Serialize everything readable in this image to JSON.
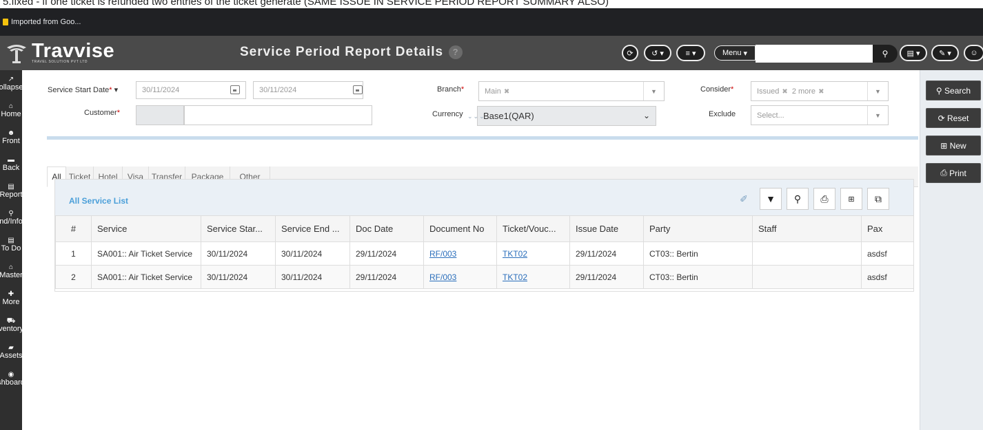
{
  "top_note": "5.fixed - if one ticket is refunded two entries of the ticket generate (SAME ISSUE IN SERVICE PERIOD REPORT SUMMARY ALSO)",
  "bookmarks": {
    "folder_label": "Imported from Goo..."
  },
  "header": {
    "logo_name": "Travvise",
    "logo_sub": "TRAVEL SOLUTION PVT LTD",
    "title": "Service Period Report Details",
    "help": "?",
    "menu_label": "Menu",
    "search_value": ""
  },
  "sidebar": {
    "items": [
      {
        "icon": "collapse-icon",
        "glyph": "↗",
        "label": "ollapse"
      },
      {
        "icon": "home-icon",
        "glyph": "⌂",
        "label": "Home"
      },
      {
        "icon": "front-icon",
        "glyph": "☻",
        "label": "Front"
      },
      {
        "icon": "back-icon",
        "glyph": "▬",
        "label": "Back"
      },
      {
        "icon": "report-icon",
        "glyph": "▤",
        "label": "Report"
      },
      {
        "icon": "info-icon",
        "glyph": "⚲",
        "label": "nd/Info"
      },
      {
        "icon": "todo-icon",
        "glyph": "▤",
        "label": "To Do"
      },
      {
        "icon": "master-icon",
        "glyph": "⌂",
        "label": "Master"
      },
      {
        "icon": "more-icon",
        "glyph": "✚",
        "label": "More"
      },
      {
        "icon": "inventory-icon",
        "glyph": "⛟",
        "label": "ventory"
      },
      {
        "icon": "assets-icon",
        "glyph": "▰",
        "label": "Assets"
      },
      {
        "icon": "dashboard-icon",
        "glyph": "◉",
        "label": "shboard"
      }
    ]
  },
  "actions": {
    "search": "Search",
    "reset": "Reset",
    "new": "New",
    "print": "Print"
  },
  "filters": {
    "service_start_label": "Service Start Date",
    "required_mark": "*",
    "date_from": "30/11/2024",
    "date_to": "30/11/2024",
    "customer_label": "Customer",
    "customer_value": "",
    "branch_label": "Branch",
    "branch_chip": "Main",
    "currency_label": "Currency",
    "currency_value": "Base1(QAR)",
    "consider_label": "Consider",
    "consider_chip": "Issued",
    "consider_more": "2 more",
    "exclude_label": "Exclude",
    "exclude_placeholder": "Select..."
  },
  "tabs": [
    "All",
    "Ticket",
    "Hotel",
    "Visa",
    "Transfer",
    "Package",
    "Other"
  ],
  "panel": {
    "title": "All Service List"
  },
  "table": {
    "columns": [
      "#",
      "Service",
      "Service Star...",
      "Service End ...",
      "Doc Date",
      "Document No",
      "Ticket/Vouc...",
      "Issue Date",
      "Party",
      "Staff",
      "Pax"
    ],
    "rows": [
      {
        "n": "1",
        "service": "SA001:: Air Ticket Service",
        "start": "30/11/2024",
        "end": "30/11/2024",
        "doc_date": "29/11/2024",
        "doc_no": "RF/003",
        "ticket": "TKT02",
        "issue": "29/11/2024",
        "party": "CT03:: Bertin",
        "staff": "",
        "pax": "asdsf"
      },
      {
        "n": "2",
        "service": "SA001:: Air Ticket Service",
        "start": "30/11/2024",
        "end": "30/11/2024",
        "doc_date": "29/11/2024",
        "doc_no": "RF/003",
        "ticket": "TKT02",
        "issue": "29/11/2024",
        "party": "CT03:: Bertin",
        "staff": "",
        "pax": "asdsf"
      }
    ]
  },
  "colors": {
    "header_bg": "#4a4a4a",
    "sidebar_bg": "#2f2f2f",
    "accent": "#4a9fd9",
    "link": "#2a6ebb"
  }
}
